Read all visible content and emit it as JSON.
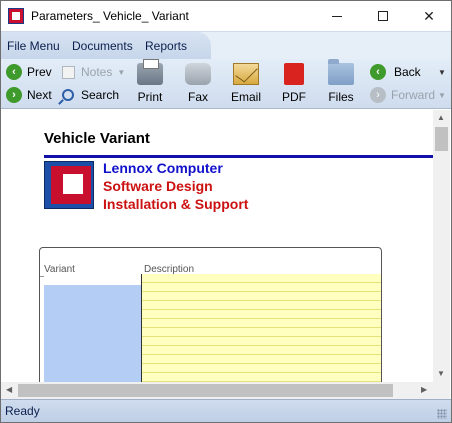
{
  "window": {
    "title": "Parameters_ Vehicle_ Variant"
  },
  "menu": {
    "items": [
      "File Menu",
      "Documents",
      "Reports"
    ]
  },
  "toolbar": {
    "prev": "Prev",
    "next": "Next",
    "notes": "Notes",
    "search": "Search",
    "print": "Print",
    "fax": "Fax",
    "email": "Email",
    "pdf": "PDF",
    "files": "Files",
    "back": "Back",
    "forward": "Forward"
  },
  "document": {
    "title": "Vehicle Variant",
    "company_lines": [
      "Lennox Computer",
      "Software Design",
      "Installation & Support"
    ],
    "columns": [
      "Variant",
      "Description"
    ]
  },
  "status": {
    "text": "Ready"
  },
  "colors": {
    "title_rule": "#1111aa",
    "company_blue": "#1111cc",
    "company_red": "#cc1111",
    "variant_fill": "#b3cdf5",
    "description_fill": "#ffffc0"
  }
}
